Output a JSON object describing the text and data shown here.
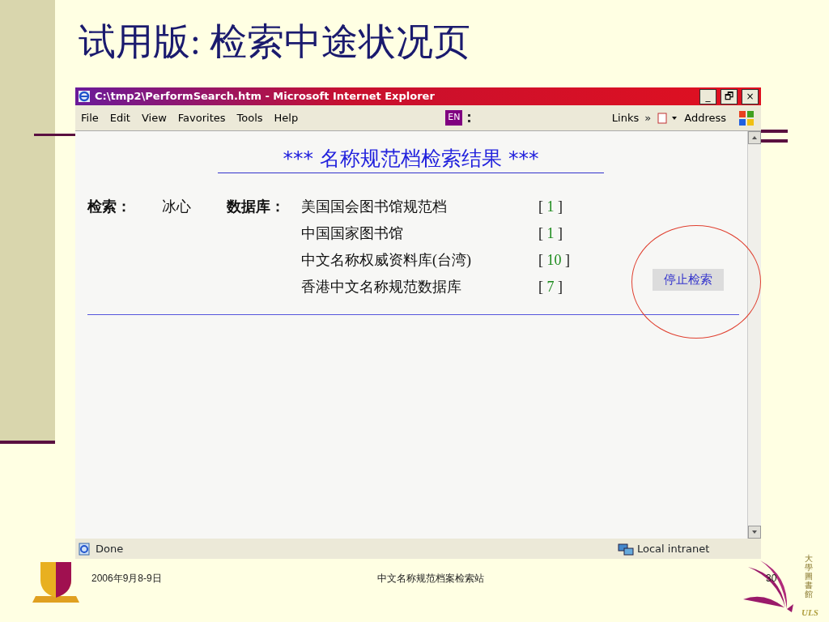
{
  "slide_title": "试用版: 检索中途状况页",
  "window": {
    "title": "C:\\tmp2\\PerformSearch.htm - Microsoft Internet Explorer",
    "controls": [
      "_",
      "🗗",
      "×"
    ]
  },
  "menu": [
    "File",
    "Edit",
    "View",
    "Favorites",
    "Tools",
    "Help"
  ],
  "toolbar": {
    "language": "EN",
    "links": "Links",
    "chevron": "»",
    "address": "Address"
  },
  "page": {
    "heading": "*** 名称规范档检索结果 ***",
    "query_label": "检索：",
    "query_value": "冰心",
    "db_label": "数据库：",
    "brackets": [
      "[",
      "]"
    ],
    "databases": [
      {
        "name": "美国国会图书馆规范档",
        "count": "1"
      },
      {
        "name": "中国国家图书馆",
        "count": "1"
      },
      {
        "name": "中文名称权威资料库(台湾)",
        "count": "10"
      },
      {
        "name": "香港中文名称规范数据库",
        "count": "7"
      }
    ],
    "stop_button": "停止检索"
  },
  "status_bar": {
    "status": "Done",
    "zone": "Local intranet"
  },
  "footer": {
    "date": "2006年9月8-9日",
    "center": "中文名称规范档案检索站",
    "page": "30"
  },
  "logo_text": {
    "vertical": "大學圖書館",
    "abbr": "ULS"
  }
}
